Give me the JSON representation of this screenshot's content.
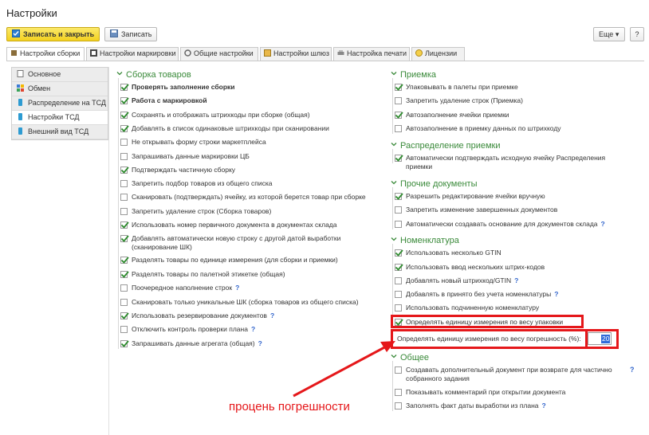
{
  "window": {
    "title": "Настройки"
  },
  "toolbar": {
    "save_close_label": "Записать и закрыть",
    "save_label": "Записать",
    "more_label": "Еще ▾",
    "help_label": "?"
  },
  "tabs": [
    {
      "label": "Настройки сборки"
    },
    {
      "label": "Настройки маркировки"
    },
    {
      "label": "Общие настройки"
    },
    {
      "label": "Настройки шлюз"
    },
    {
      "label": "Настройка печати"
    },
    {
      "label": "Лицензии"
    }
  ],
  "sidebar": {
    "items": [
      {
        "label": "Основное"
      },
      {
        "label": "Обмен"
      },
      {
        "label": "Распределение на ТСД"
      },
      {
        "label": "Настройки ТСД"
      },
      {
        "label": "Внешний вид ТСД"
      }
    ]
  },
  "groups": {
    "assembly": {
      "title": "Сборка товаров",
      "items": [
        {
          "label": "Проверять заполнение сборки",
          "checked": true
        },
        {
          "label": "Работа с маркировкой",
          "checked": true
        },
        {
          "label": "Сохранять  и отображать штрихкоды при сборке (общая)",
          "checked": true
        },
        {
          "label": "Добавлять в список одинаковые штрихкоды при сканировании",
          "checked": true
        },
        {
          "label": "Не открывать форму строки маркетплейса",
          "checked": false
        },
        {
          "label": "Запрашивать данные маркировки ЦБ",
          "checked": false
        },
        {
          "label": "Подтверждать частичную сборку",
          "checked": true
        },
        {
          "label": "Запретить подбор товаров из общего списка",
          "checked": false
        },
        {
          "label": "Сканировать (подтверждать) ячейку, из которой берется товар при сборке",
          "checked": false
        },
        {
          "label": "Запретить удаление строк (Сборка товаров)",
          "checked": false
        },
        {
          "label": "Использовать номер первичного документа в документах склада",
          "checked": true
        },
        {
          "label": "Добавлять автоматически новую строку с другой датой выработки",
          "label2": "(сканирование ШК)",
          "checked": true
        },
        {
          "label": "Разделять товары по единице измерения (для сборки и приемки)",
          "checked": true
        },
        {
          "label": "Разделять товары по палетной этикетке (общая)",
          "checked": true
        },
        {
          "label": "Поочередное наполнение строк",
          "checked": false,
          "help": "?"
        },
        {
          "label": "Сканировать только уникальные ШК (сборка товаров из общего списка)",
          "checked": false
        },
        {
          "label": "Использовать резервирование документов",
          "checked": true,
          "help": "?"
        },
        {
          "label": "Отключить контроль проверки плана",
          "checked": false,
          "help": "?"
        },
        {
          "label": "Запрашивать данные агрегата (общая)",
          "checked": true,
          "help": "?"
        }
      ]
    },
    "receiving": {
      "title": "Приемка",
      "items": [
        {
          "label": "Упаковывать в палеты при приемке",
          "checked": true
        },
        {
          "label": "Запретить удаление строк (Приемка)",
          "checked": false
        },
        {
          "label": "Автозаполнение ячейки приемки",
          "checked": true
        },
        {
          "label": "Автозаполнение в приемку данных по штрихкоду",
          "checked": false
        }
      ]
    },
    "distribution": {
      "title": "Распределение приемки",
      "items": [
        {
          "label": "Автоматически подтверждать исходную ячейку Распределения",
          "label2": "приемки",
          "checked": true
        }
      ]
    },
    "other_docs": {
      "title": "Прочие документы",
      "items": [
        {
          "label": "Разрешить редактирование ячейки вручную",
          "checked": true
        },
        {
          "label": "Запретить изменение завершенных документов",
          "checked": false
        },
        {
          "label": "Автоматически создавать основание для документов склада",
          "checked": false,
          "help": "?"
        }
      ]
    },
    "nomenclature": {
      "title": "Номенклатура",
      "items": [
        {
          "label": "Использовать несколько GTIN",
          "checked": true
        },
        {
          "label": "Использовать ввод нескольких штрих-кодов",
          "checked": true
        },
        {
          "label": "Добавлять новый штрихкод/GTIN",
          "checked": false,
          "help": "?"
        },
        {
          "label": "Добавлять в принято без учета номенклатуры",
          "checked": false,
          "help": "?"
        },
        {
          "label": "Использовать подчиненную номенклатуру",
          "checked": false
        },
        {
          "label": "Определять единицу измерения по весу упаковки",
          "checked": true
        }
      ],
      "tolerance_label": "Определять единицу измерения по весу погрешность (%):",
      "tolerance_value": "20"
    },
    "general": {
      "title": "Общее",
      "items": [
        {
          "label": "Создавать дополнительный документ при возврате для частично",
          "label2": "собранного задания",
          "checked": false,
          "help": "?"
        },
        {
          "label": "Показывать комментарий при открытии документа",
          "checked": false
        },
        {
          "label": "Заполнять факт даты выработки из плана",
          "checked": false,
          "help": "?"
        }
      ]
    }
  },
  "annotation": {
    "text": "процень погрешности"
  },
  "colors": {
    "accent_green": "#3a8a3a",
    "highlight_red": "#e5171a",
    "primary_yellow": "#f3d11f",
    "help_blue": "#3366cc"
  }
}
